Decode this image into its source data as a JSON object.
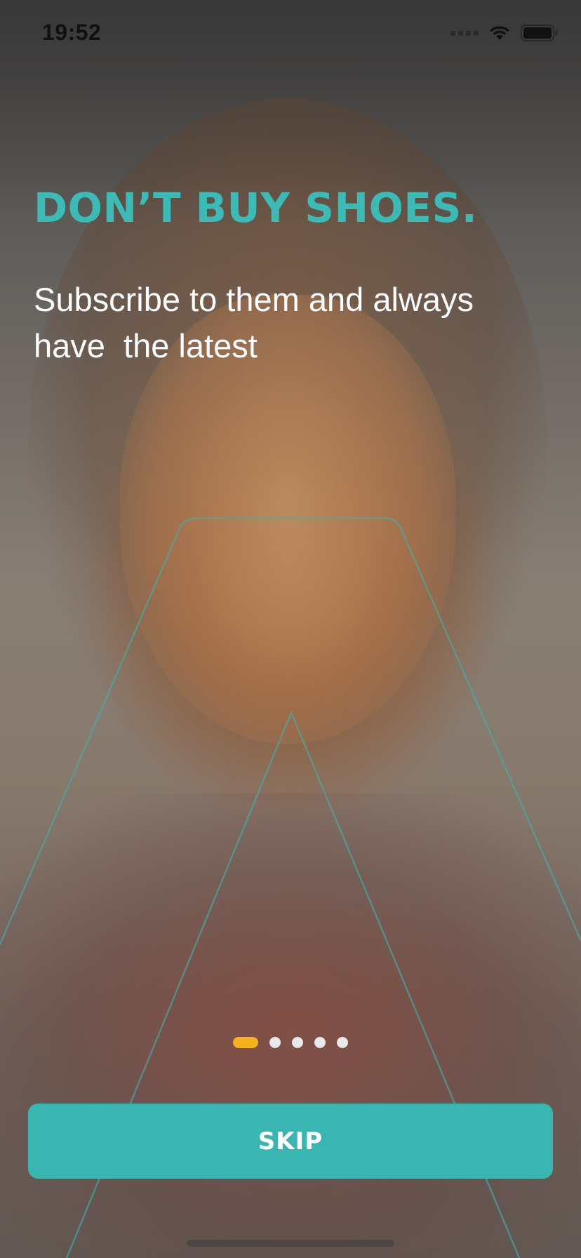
{
  "status_bar": {
    "time": "19:52",
    "icons": [
      "cellular-signal-icon",
      "wifi-icon",
      "battery-icon"
    ]
  },
  "onboarding": {
    "headline": "DON’T BUY SHOES.",
    "subtitle": "Subscribe to them and always\nhave  the latest",
    "pager": {
      "total_pages": 5,
      "current_page": 1
    },
    "skip_label": "SKIP"
  },
  "colors": {
    "accent_teal": "#3ab6b2",
    "pager_active": "#f5b21c",
    "pager_inactive": "#e9e9e9"
  }
}
